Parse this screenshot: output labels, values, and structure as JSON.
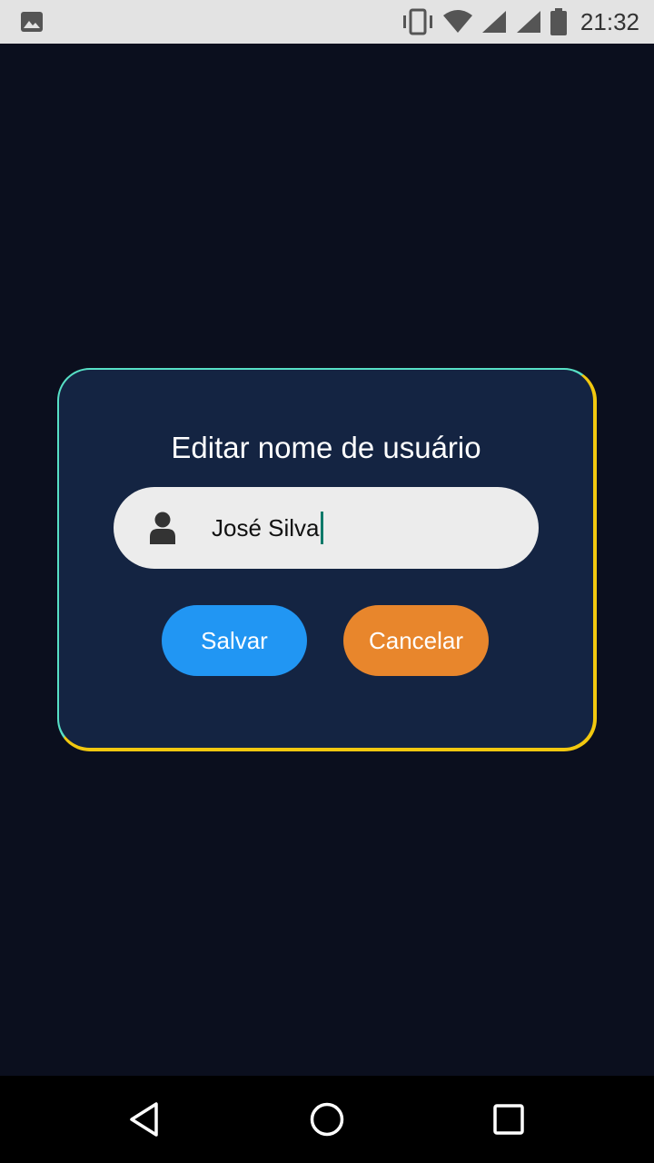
{
  "status_bar": {
    "time": "21:32",
    "icons": [
      "image-icon",
      "vibrate-icon",
      "wifi-icon",
      "signal-icon",
      "signal-icon",
      "battery-icon"
    ]
  },
  "dialog": {
    "title": "Editar nome de usuário",
    "input": {
      "value": "José Silva",
      "icon": "user-icon"
    },
    "buttons": {
      "save_label": "Salvar",
      "cancel_label": "Cancelar"
    },
    "colors": {
      "background": "#142442",
      "border_top_left": "#57e0c6",
      "border_bottom_right": "#f2c80f",
      "save": "#2196f3",
      "cancel": "#e8862c"
    }
  },
  "nav_bar": {
    "icons": [
      "back-icon",
      "home-icon",
      "recents-icon"
    ]
  }
}
